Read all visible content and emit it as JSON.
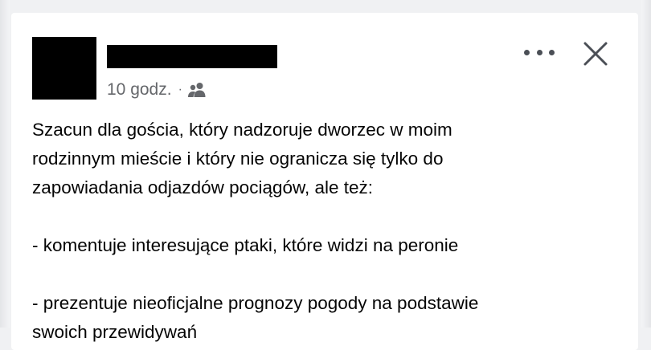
{
  "post": {
    "timestamp": "10 godz.",
    "separator": "·",
    "audience_icon": "friends-audience-icon",
    "paragraph_1": "Szacun dla gościa, który nadzoruje dworzec w moim\nrodzinnym mieście i który nie ogranicza się tylko do\nzapowiadania odjazdów pociągów, ale też:",
    "bullet_1": "- komentuje interesujące ptaki, które widzi na peronie",
    "bullet_2": "- prezentuje nieoficjalne prognozy pogody na podstawie\nswoich przewidywań"
  },
  "icons": {
    "more": "more-options-icon",
    "close": "close-icon"
  },
  "colors": {
    "text": "#050505",
    "meta": "#65676b",
    "redaction": "#000000",
    "background": "#f0f1f3"
  }
}
